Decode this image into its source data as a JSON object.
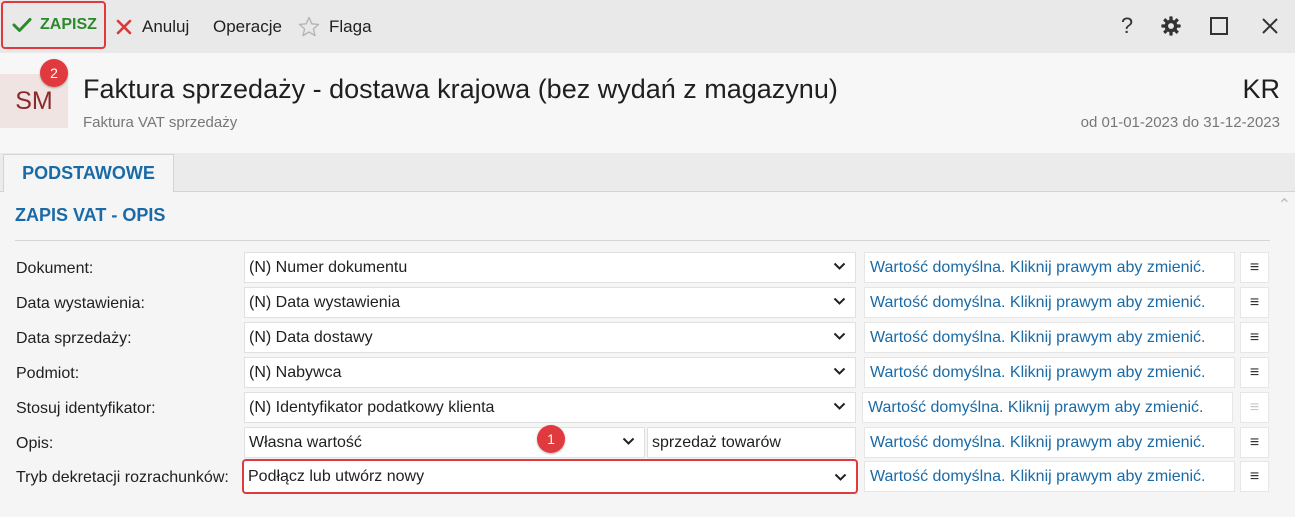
{
  "toolbar": {
    "save_label": "ZAPISZ",
    "cancel_label": "Anuluj",
    "operations_label": "Operacje",
    "flag_label": "Flaga",
    "help_label": "?"
  },
  "header": {
    "avatar_text": "SM",
    "title": "Faktura sprzedaży - dostawa krajowa (bez wydań z magazynu)",
    "subtitle": "Faktura VAT sprzedaży",
    "code": "KR",
    "period": "od 01-01-2023 do 31-12-2023"
  },
  "callouts": {
    "one": "1",
    "two": "2"
  },
  "tabs": [
    {
      "label": "PODSTAWOWE",
      "active": true
    }
  ],
  "section": {
    "title": "ZAPIS VAT - OPIS"
  },
  "rows": [
    {
      "label": "Dokument:",
      "value": "(N) Numer dokumentu",
      "default_text": "Wartość domyślna. Kliknij prawym aby zmienić.",
      "menu": "≡"
    },
    {
      "label": "Data wystawienia:",
      "value": "(N) Data wystawienia",
      "default_text": "Wartość domyślna. Kliknij prawym aby zmienić.",
      "menu": "≡"
    },
    {
      "label": "Data sprzedaży:",
      "value": "(N) Data dostawy",
      "default_text": "Wartość domyślna. Kliknij prawym aby zmienić.",
      "menu": "≡"
    },
    {
      "label": "Podmiot:",
      "value": "(N) Nabywca",
      "default_text": "Wartość domyślna. Kliknij prawym aby zmienić.",
      "menu": "≡"
    },
    {
      "label": "Stosuj identyfikator:",
      "value": "(N) Identyfikator podatkowy klienta",
      "default_text": "Wartość domyślna. Kliknij prawym aby zmienić.",
      "menu": "≡"
    },
    {
      "label": "Opis:",
      "value": "Własna wartość",
      "extra_value": "sprzedaż towarów",
      "default_text": "Wartość domyślna. Kliknij prawym aby zmienić.",
      "menu": "≡"
    },
    {
      "label": "Tryb dekretacji rozrachunków:",
      "value": "Podłącz lub utwórz nowy",
      "default_text": "Wartość domyślna. Kliknij prawym aby zmienić.",
      "menu": "≡"
    }
  ],
  "colors": {
    "accent_blue": "#1a6aa6",
    "save_green": "#2b8a2b",
    "highlight_red": "#e0393e"
  }
}
